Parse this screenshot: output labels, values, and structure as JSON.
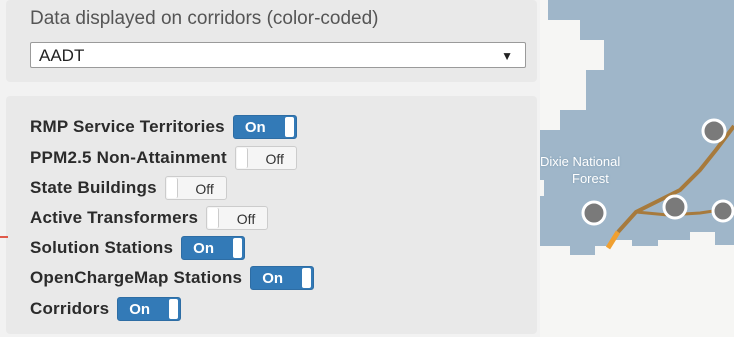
{
  "data_section": {
    "label": "Data displayed on corridors (color-coded)",
    "selected": "AADT"
  },
  "layers": [
    {
      "label": "RMP Service Territories",
      "state": "On"
    },
    {
      "label": "PPM2.5 Non-Attainment",
      "state": "Off"
    },
    {
      "label": "State Buildings",
      "state": "Off"
    },
    {
      "label": "Active Transformers",
      "state": "Off"
    },
    {
      "label": "Solution Stations",
      "state": "On"
    },
    {
      "label": "OpenChargeMap Stations",
      "state": "On"
    },
    {
      "label": "Corridors",
      "state": "On"
    }
  ],
  "map": {
    "label_line1": "Dixie National",
    "label_line2": "Forest"
  },
  "colors": {
    "toggle_on": "#337ab7",
    "territory": "#9fb6c9",
    "station": "#7a7a7a",
    "corridor": "#a77a3c",
    "corridor_highlight": "#f0a030"
  }
}
